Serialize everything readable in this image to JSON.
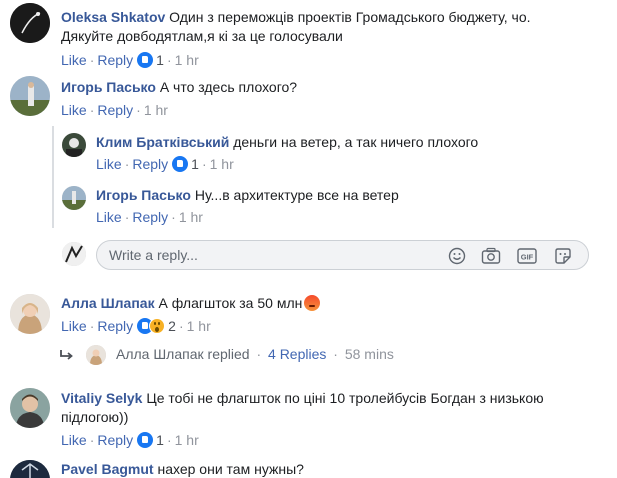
{
  "comments": [
    {
      "author": "Oleksa Shkatov",
      "text_line1": "Один з переможців проектів Громадського бюджету, чо.",
      "text_line2": "Дякуйте довбодятлам,я кі за це голосували",
      "like": "Like",
      "reply": "Reply",
      "reactions_count": "1",
      "time": "1 hr"
    },
    {
      "author": "Игорь Пасько",
      "text": "А что здесь плохого?",
      "like": "Like",
      "reply": "Reply",
      "time": "1 hr",
      "replies": [
        {
          "author": "Клим Братківський",
          "text": "деньги на ветер, а так ничего плохого",
          "like": "Like",
          "reply": "Reply",
          "reactions_count": "1",
          "time": "1 hr"
        },
        {
          "author": "Игорь Пасько",
          "text": "Ну...в архитектуре все на ветер",
          "like": "Like",
          "reply": "Reply",
          "time": "1 hr"
        }
      ]
    },
    {
      "author": "Алла Шлапак",
      "text": "А флагшток за 50 млн",
      "like": "Like",
      "reply": "Reply",
      "reactions_count": "2",
      "time": "1 hr",
      "replied": {
        "author": "Алла Шлапак",
        "replied_label": "replied",
        "replies_link": "4 Replies",
        "time": "58 mins"
      }
    },
    {
      "author": "Vitaliy Selyk",
      "text_line1": "Це тобі не флагшток по ціні 10 тролейбусів Богдан з низькою",
      "text_line2": "підлогою))",
      "like": "Like",
      "reply": "Reply",
      "reactions_count": "1",
      "time": "1 hr"
    },
    {
      "author": "Pavel Bagmut",
      "text": "нахер они там нужны?"
    }
  ],
  "reply_input": {
    "placeholder": "Write a reply..."
  },
  "icons": {
    "reply_box": [
      "emoji-icon",
      "camera-icon",
      "gif-icon",
      "sticker-icon"
    ],
    "reactions": [
      "like-reaction-icon",
      "wow-reaction-icon",
      "angry-emoji-icon"
    ]
  },
  "colors": {
    "author": "#385898",
    "link": "#4267b2",
    "meta": "#90949c",
    "like_blue": "#1877f2"
  }
}
